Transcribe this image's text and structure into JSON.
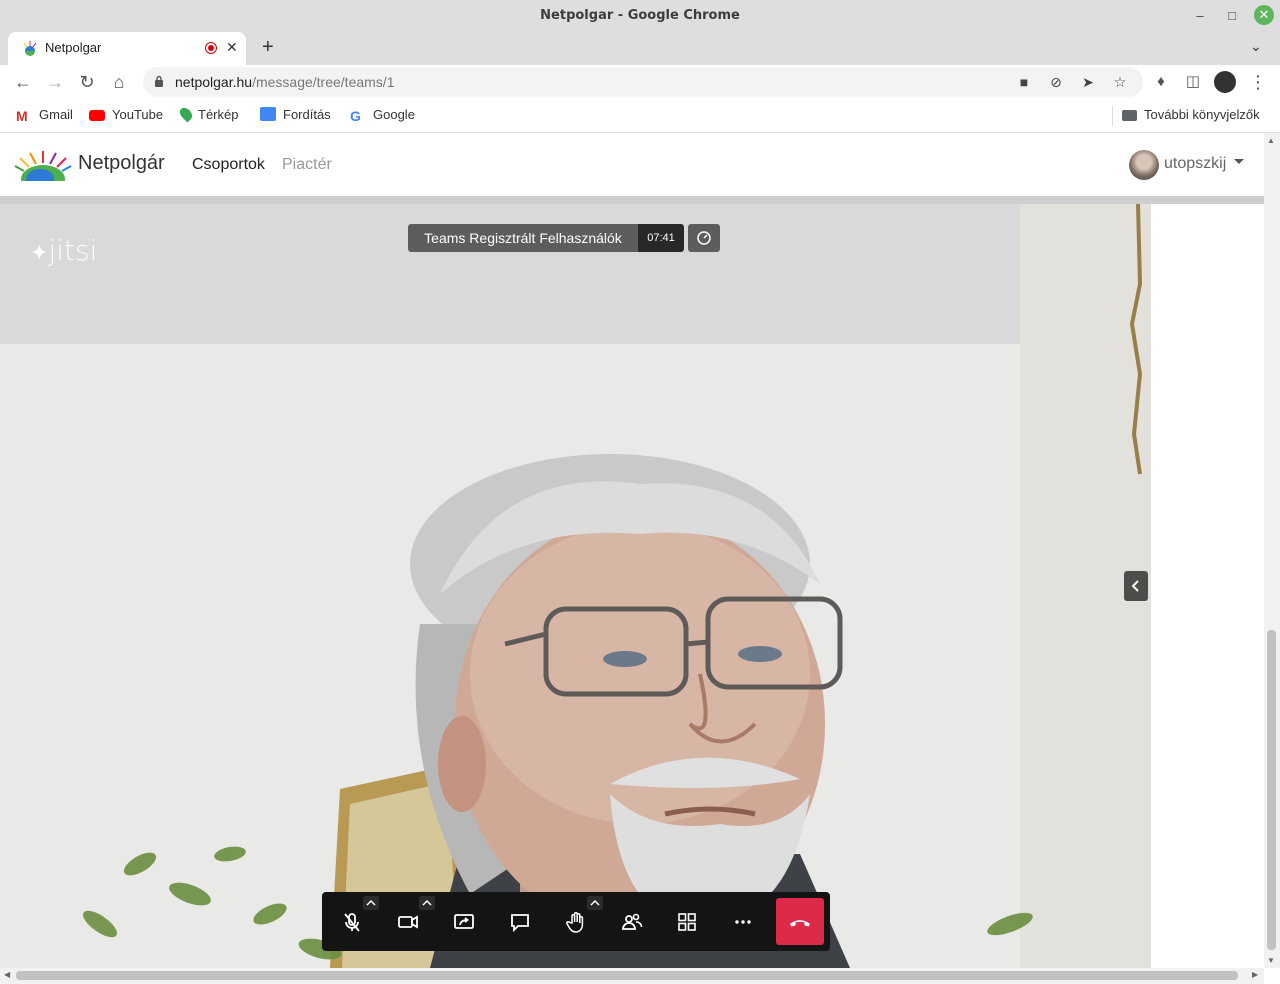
{
  "window": {
    "title": "Netpolgar - Google Chrome"
  },
  "tab": {
    "title": "Netpolgar",
    "favicon_icon": "netpolgar-favicon-icon",
    "recording_indicator": "recording-dot-icon"
  },
  "address_bar": {
    "host": "netpolgar.hu",
    "path": "/message/tree/teams/1"
  },
  "bookmarks": {
    "items": [
      {
        "label": "Gmail",
        "icon": "gmail-icon",
        "color": "#d93025"
      },
      {
        "label": "YouTube",
        "icon": "youtube-icon",
        "color": "#ff0000"
      },
      {
        "label": "Térkép",
        "icon": "maps-icon",
        "color": "#34a853"
      },
      {
        "label": "Fordítás",
        "icon": "translate-icon",
        "color": "#4285f4"
      },
      {
        "label": "Google",
        "icon": "google-icon",
        "color": "#4285f4"
      }
    ],
    "other_label": "További könyvjelzők"
  },
  "site": {
    "brand": "Netpolgár",
    "nav": {
      "groups": "Csoportok",
      "market": "Piactér"
    },
    "user": {
      "name": "utopszkij"
    }
  },
  "meeting": {
    "logo": "jitsi",
    "room_name": "Teams Regisztrált Felhasználók",
    "timer": "07:41"
  },
  "colors": {
    "hangup": "#dd2a48",
    "toolbox_bg": "#141414"
  }
}
